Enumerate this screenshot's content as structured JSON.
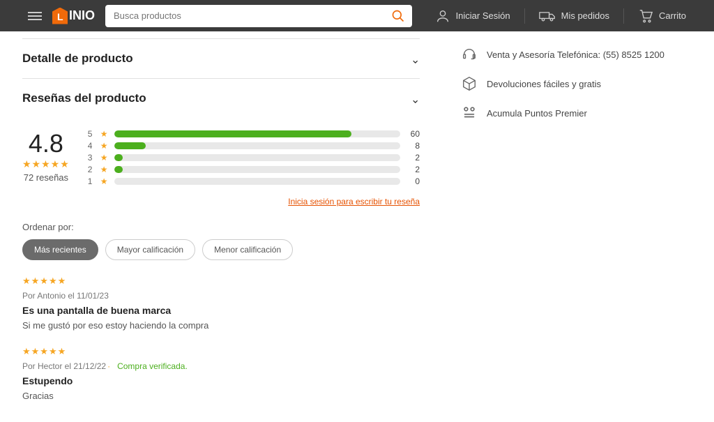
{
  "header": {
    "search_placeholder": "Busca productos",
    "login": "Iniciar Sesión",
    "orders": "Mis pedidos",
    "cart": "Carrito",
    "logo": "INIO"
  },
  "sections": {
    "detail": "Detalle de producto",
    "reviews": "Reseñas del producto"
  },
  "summary": {
    "avg": "4.8",
    "count_label": "72 reseñas",
    "distribution": [
      {
        "stars": "5",
        "count": "60",
        "pct": 83
      },
      {
        "stars": "4",
        "count": "8",
        "pct": 11
      },
      {
        "stars": "3",
        "count": "2",
        "pct": 3
      },
      {
        "stars": "2",
        "count": "2",
        "pct": 3
      },
      {
        "stars": "1",
        "count": "0",
        "pct": 0
      }
    ],
    "login_prompt": "Inicia sesión para escribir tu reseña"
  },
  "sort": {
    "label": "Ordenar por:",
    "options": [
      "Más recientes",
      "Mayor calificación",
      "Menor calificación"
    ],
    "active": 0
  },
  "reviews": [
    {
      "meta": "Por Antonio el 11/01/23",
      "verified": "",
      "title": "Es una pantalla de buena marca",
      "body": "Si me gustó por eso estoy haciendo la compra"
    },
    {
      "meta": "Por Hector el 21/12/22",
      "verified": "Compra verificada.",
      "title": "Estupendo",
      "body": "Gracias"
    }
  ],
  "benefits": {
    "phone": "Venta y Asesoría Telefónica: (55) 8525 1200",
    "returns": "Devoluciones fáciles y gratis",
    "points": "Acumula Puntos Premier"
  }
}
